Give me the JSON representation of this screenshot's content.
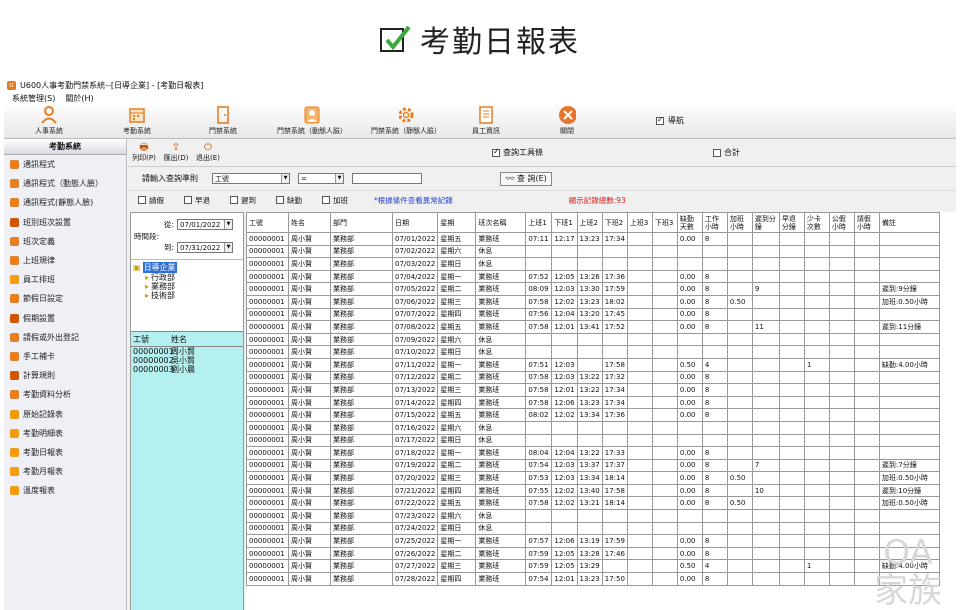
{
  "page_title": "考勤日報表",
  "window": {
    "title": "U600人事考勤門禁系統--[日導企業] - [考勤日報表]"
  },
  "menubar": [
    "系統管理(S)",
    "關於(H)"
  ],
  "toolbar": {
    "items": [
      "人事系統",
      "考勤系統",
      "門禁系統",
      "門禁系統（動態人臉）",
      "門禁系統（靜態人臉）",
      "員工資訊",
      "關閉"
    ],
    "guide_label": "導航",
    "guide_checked": true
  },
  "sidebar": {
    "title": "考勤系統",
    "items": [
      "通訊程式",
      "通訊程式（動態人臉）",
      "通訊程式(靜態人臉)",
      "班別班次設置",
      "班次定義",
      "上班規律",
      "員工排班",
      "節假日設定",
      "假期設置",
      "請假或外出登記",
      "手工補卡",
      "計算規則",
      "考勤資料分析",
      "原始記錄表",
      "考勤明細表",
      "考勤日報表",
      "考勤月報表",
      "溫度報表"
    ]
  },
  "query_bar": {
    "print": "列印(P)",
    "export": "匯出(D)",
    "exit": "退出(E)",
    "show_toolbar": "查詢工具條",
    "show_toolbar_checked": true,
    "total": "合計",
    "total_checked": false
  },
  "criteria": {
    "label": "請輸入查詢準則",
    "field": "工號",
    "op": "=",
    "value": "",
    "search": "查 詢(E)"
  },
  "filters": {
    "items": [
      "請假",
      "早退",
      "遲到",
      "缺勤",
      "加班"
    ],
    "hint": "*根據條件查看異常記錄",
    "count": "顯示記錄總數:93"
  },
  "date_range": {
    "from_label": "從:",
    "from": "07/01/2022",
    "label": "時間段:",
    "to_label": "到:",
    "to": "07/31/2022"
  },
  "tree": {
    "root": "日導企業",
    "children": [
      "行政部",
      "業務部",
      "技術部"
    ]
  },
  "employees": {
    "headers": [
      "工號",
      "姓名"
    ],
    "rows": [
      [
        "00000001",
        "周小賢"
      ],
      [
        "00000002",
        "吳小賢"
      ],
      [
        "00000003",
        "劉小晨"
      ]
    ]
  },
  "grid": {
    "headers": [
      "工號",
      "姓名",
      "部門",
      "日期",
      "星期",
      "班次名稱",
      "上班1",
      "下班1",
      "上班2",
      "下班2",
      "上班3",
      "下班3",
      "缺勤天數",
      "工作小時",
      "加班小時",
      "遲到分鐘",
      "早退分鐘",
      "少卡次數",
      "公假小時",
      "請假小時",
      "備註"
    ],
    "rows": [
      [
        "00000001",
        "周小賢",
        "業務部",
        "07/01/2022",
        "星期五",
        "業務班",
        "07:11",
        "12:17",
        "13:23",
        "17:34",
        "",
        "",
        "0.00",
        "8",
        "",
        "",
        "",
        "",
        "",
        "",
        ""
      ],
      [
        "00000001",
        "周小賢",
        "業務部",
        "07/02/2022",
        "星期六",
        "休息",
        "",
        "",
        "",
        "",
        "",
        "",
        "",
        "",
        "",
        "",
        "",
        "",
        "",
        "",
        ""
      ],
      [
        "00000001",
        "周小賢",
        "業務部",
        "07/03/2022",
        "星期日",
        "休息",
        "",
        "",
        "",
        "",
        "",
        "",
        "",
        "",
        "",
        "",
        "",
        "",
        "",
        "",
        ""
      ],
      [
        "00000001",
        "周小賢",
        "業務部",
        "07/04/2022",
        "星期一",
        "業務班",
        "07:52",
        "12:05",
        "13:26",
        "17:36",
        "",
        "",
        "0.00",
        "8",
        "",
        "",
        "",
        "",
        "",
        "",
        ""
      ],
      [
        "00000001",
        "周小賢",
        "業務部",
        "07/05/2022",
        "星期二",
        "業務班",
        "08:09",
        "12:03",
        "13:30",
        "17:59",
        "",
        "",
        "0.00",
        "8",
        "",
        "9",
        "",
        "",
        "",
        "",
        "遲到:9分鐘"
      ],
      [
        "00000001",
        "周小賢",
        "業務部",
        "07/06/2022",
        "星期三",
        "業務班",
        "07:58",
        "12:02",
        "13:23",
        "18:02",
        "",
        "",
        "0.00",
        "8",
        "0.50",
        "",
        "",
        "",
        "",
        "",
        "加班:0.50小時"
      ],
      [
        "00000001",
        "周小賢",
        "業務部",
        "07/07/2022",
        "星期四",
        "業務班",
        "07:56",
        "12:04",
        "13:20",
        "17:45",
        "",
        "",
        "0.00",
        "8",
        "",
        "",
        "",
        "",
        "",
        "",
        ""
      ],
      [
        "00000001",
        "周小賢",
        "業務部",
        "07/08/2022",
        "星期五",
        "業務班",
        "07:58",
        "12:01",
        "13:41",
        "17:52",
        "",
        "",
        "0.00",
        "8",
        "",
        "11",
        "",
        "",
        "",
        "",
        "遲到:11分鐘"
      ],
      [
        "00000001",
        "周小賢",
        "業務部",
        "07/09/2022",
        "星期六",
        "休息",
        "",
        "",
        "",
        "",
        "",
        "",
        "",
        "",
        "",
        "",
        "",
        "",
        "",
        "",
        ""
      ],
      [
        "00000001",
        "周小賢",
        "業務部",
        "07/10/2022",
        "星期日",
        "休息",
        "",
        "",
        "",
        "",
        "",
        "",
        "",
        "",
        "",
        "",
        "",
        "",
        "",
        "",
        ""
      ],
      [
        "00000001",
        "周小賢",
        "業務部",
        "07/11/2022",
        "星期一",
        "業務班",
        "07:51",
        "12:03",
        "",
        "17:58",
        "",
        "",
        "0.50",
        "4",
        "",
        "",
        "",
        "1",
        "",
        "",
        "缺勤:4.00小時"
      ],
      [
        "00000001",
        "周小賢",
        "業務部",
        "07/12/2022",
        "星期二",
        "業務班",
        "07:58",
        "12:03",
        "13:22",
        "17:32",
        "",
        "",
        "0.00",
        "8",
        "",
        "",
        "",
        "",
        "",
        "",
        ""
      ],
      [
        "00000001",
        "周小賢",
        "業務部",
        "07/13/2022",
        "星期三",
        "業務班",
        "07:58",
        "12:01",
        "13:22",
        "17:34",
        "",
        "",
        "0.00",
        "8",
        "",
        "",
        "",
        "",
        "",
        "",
        ""
      ],
      [
        "00000001",
        "周小賢",
        "業務部",
        "07/14/2022",
        "星期四",
        "業務班",
        "07:58",
        "12:06",
        "13:23",
        "17:34",
        "",
        "",
        "0.00",
        "8",
        "",
        "",
        "",
        "",
        "",
        "",
        ""
      ],
      [
        "00000001",
        "周小賢",
        "業務部",
        "07/15/2022",
        "星期五",
        "業務班",
        "08:02",
        "12:02",
        "13:34",
        "17:36",
        "",
        "",
        "0.00",
        "8",
        "",
        "",
        "",
        "",
        "",
        "",
        ""
      ],
      [
        "00000001",
        "周小賢",
        "業務部",
        "07/16/2022",
        "星期六",
        "休息",
        "",
        "",
        "",
        "",
        "",
        "",
        "",
        "",
        "",
        "",
        "",
        "",
        "",
        "",
        ""
      ],
      [
        "00000001",
        "周小賢",
        "業務部",
        "07/17/2022",
        "星期日",
        "休息",
        "",
        "",
        "",
        "",
        "",
        "",
        "",
        "",
        "",
        "",
        "",
        "",
        "",
        "",
        ""
      ],
      [
        "00000001",
        "周小賢",
        "業務部",
        "07/18/2022",
        "星期一",
        "業務班",
        "08:04",
        "12:04",
        "13:22",
        "17:33",
        "",
        "",
        "0.00",
        "8",
        "",
        "",
        "",
        "",
        "",
        "",
        ""
      ],
      [
        "00000001",
        "周小賢",
        "業務部",
        "07/19/2022",
        "星期二",
        "業務班",
        "07:54",
        "12:03",
        "13:37",
        "17:37",
        "",
        "",
        "0.00",
        "8",
        "",
        "7",
        "",
        "",
        "",
        "",
        "遲到:7分鐘"
      ],
      [
        "00000001",
        "周小賢",
        "業務部",
        "07/20/2022",
        "星期三",
        "業務班",
        "07:53",
        "12:03",
        "13:34",
        "18:14",
        "",
        "",
        "0.00",
        "8",
        "0.50",
        "",
        "",
        "",
        "",
        "",
        "加班:0.50小時"
      ],
      [
        "00000001",
        "周小賢",
        "業務部",
        "07/21/2022",
        "星期四",
        "業務班",
        "07:55",
        "12:02",
        "13:40",
        "17:58",
        "",
        "",
        "0.00",
        "8",
        "",
        "10",
        "",
        "",
        "",
        "",
        "遲到:10分鐘"
      ],
      [
        "00000001",
        "周小賢",
        "業務部",
        "07/22/2022",
        "星期五",
        "業務班",
        "07:58",
        "12:02",
        "13:21",
        "18:14",
        "",
        "",
        "0.00",
        "8",
        "0.50",
        "",
        "",
        "",
        "",
        "",
        "加班:0.50小時"
      ],
      [
        "00000001",
        "周小賢",
        "業務部",
        "07/23/2022",
        "星期六",
        "休息",
        "",
        "",
        "",
        "",
        "",
        "",
        "",
        "",
        "",
        "",
        "",
        "",
        "",
        "",
        ""
      ],
      [
        "00000001",
        "周小賢",
        "業務部",
        "07/24/2022",
        "星期日",
        "休息",
        "",
        "",
        "",
        "",
        "",
        "",
        "",
        "",
        "",
        "",
        "",
        "",
        "",
        "",
        ""
      ],
      [
        "00000001",
        "周小賢",
        "業務部",
        "07/25/2022",
        "星期一",
        "業務班",
        "07:57",
        "12:06",
        "13:19",
        "17:59",
        "",
        "",
        "0.00",
        "8",
        "",
        "",
        "",
        "",
        "",
        "",
        ""
      ],
      [
        "00000001",
        "周小賢",
        "業務部",
        "07/26/2022",
        "星期二",
        "業務班",
        "07:59",
        "12:05",
        "13:28",
        "17:46",
        "",
        "",
        "0.00",
        "8",
        "",
        "",
        "",
        "",
        "",
        "",
        ""
      ],
      [
        "00000001",
        "周小賢",
        "業務部",
        "07/27/2022",
        "星期三",
        "業務班",
        "07:59",
        "12:05",
        "13:29",
        "",
        "",
        "",
        "0.50",
        "4",
        "",
        "",
        "",
        "1",
        "",
        "",
        "缺勤:4.00小時"
      ],
      [
        "00000001",
        "周小賢",
        "業務部",
        "07/28/2022",
        "星期四",
        "業務班",
        "07:54",
        "12:01",
        "13:23",
        "17:50",
        "",
        "",
        "0.00",
        "8",
        "",
        "",
        "",
        "",
        "",
        "",
        ""
      ]
    ]
  },
  "watermark": {
    "line1": "OA",
    "line2": "家族"
  },
  "colors": {
    "accent": "#d35400",
    "highlight": "#b5f0f0",
    "tree_selected": "#2f6fd6",
    "hint": "#2040d0",
    "count": "#e02020"
  }
}
